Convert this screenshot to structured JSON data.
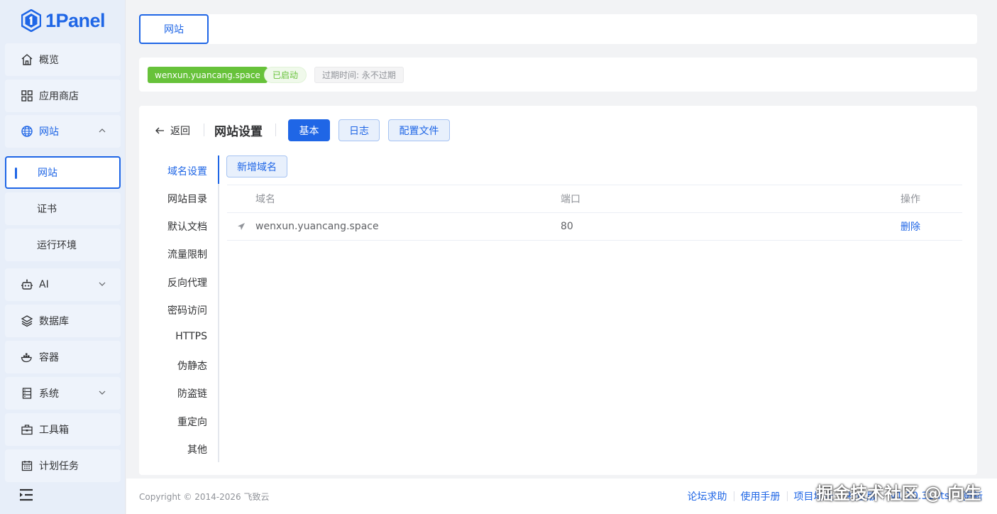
{
  "app": {
    "name": "1Panel"
  },
  "sidebar": {
    "items": [
      {
        "label": "概览",
        "icon": "home-icon"
      },
      {
        "label": "应用商店",
        "icon": "grid-icon"
      },
      {
        "label": "网站",
        "icon": "globe-icon",
        "expanded": true,
        "children": [
          {
            "label": "网站"
          },
          {
            "label": "证书"
          },
          {
            "label": "运行环境"
          }
        ]
      },
      {
        "label": "AI",
        "icon": "robot-icon"
      },
      {
        "label": "数据库",
        "icon": "layers-icon"
      },
      {
        "label": "容器",
        "icon": "container-icon"
      },
      {
        "label": "系统",
        "icon": "server-icon"
      },
      {
        "label": "工具箱",
        "icon": "toolbox-icon"
      },
      {
        "label": "计划任务",
        "icon": "calendar-icon"
      }
    ]
  },
  "tabs": {
    "active": "网站"
  },
  "site": {
    "domain_tag": "wenxun.yuancang.space",
    "status": "已启动",
    "expire": "过期时间: 永不过期"
  },
  "settings": {
    "back_label": "返回",
    "title": "网站设置",
    "buttons": {
      "basic": "基本",
      "log": "日志",
      "config": "配置文件"
    },
    "subnav": [
      "域名设置",
      "网站目录",
      "默认文档",
      "流量限制",
      "反向代理",
      "密码访问",
      "HTTPS",
      "伪静态",
      "防盗链",
      "重定向",
      "其他"
    ],
    "add_domain": "新增域名",
    "table": {
      "headers": {
        "domain": "域名",
        "port": "端口",
        "action": "操作"
      },
      "rows": [
        {
          "domain": "wenxun.yuancang.space",
          "port": "80",
          "action": "删除"
        }
      ]
    }
  },
  "footer": {
    "copyright": "Copyright © 2014-2026 飞致云",
    "links": [
      "论坛求助",
      "使用手册",
      "项目地址",
      "社区版",
      "v1.10.31-lts",
      "更新"
    ]
  },
  "watermark": "掘金技术社区 @ 向生",
  "colors": {
    "primary": "#1f66e6",
    "success": "#67c23a"
  }
}
